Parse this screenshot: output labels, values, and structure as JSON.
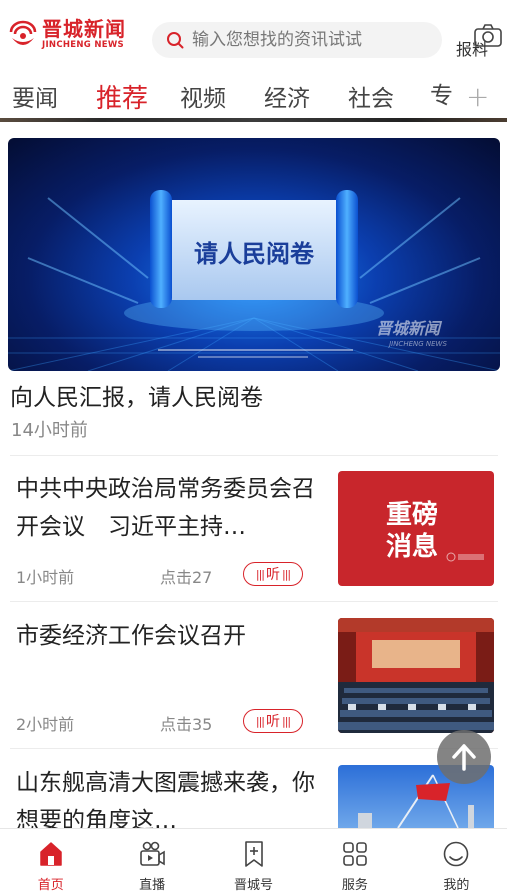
{
  "header": {
    "logo_cn": "晋城新闻",
    "logo_en": "JINCHENG NEWS",
    "search_placeholder": "输入您想找的资讯试试",
    "report_label": "报料"
  },
  "tabs": [
    {
      "label": "要闻",
      "active": false
    },
    {
      "label": "推荐",
      "active": true
    },
    {
      "label": "视频",
      "active": false
    },
    {
      "label": "经济",
      "active": false
    },
    {
      "label": "社会",
      "active": false
    },
    {
      "label": "专",
      "active": false
    }
  ],
  "hero": {
    "banner_text": "请人民阅卷",
    "watermark": "晋城新闻",
    "watermark_en": "JINCHENG NEWS",
    "title": "向人民汇报，请人民阅卷",
    "time": "14小时前"
  },
  "news": [
    {
      "title": "中共中央政治局常务委员会召开会议　习近平主持…",
      "time": "1小时前",
      "clicks": "点击27",
      "listen": "听",
      "thumb_text_1": "重磅",
      "thumb_text_2": "消息"
    },
    {
      "title": "市委经济工作会议召开",
      "time": "2小时前",
      "clicks": "点击35",
      "listen": "听"
    },
    {
      "title": "山东舰高清大图震撼来袭，你想要的角度这…"
    }
  ],
  "bottom_nav": [
    {
      "label": "首页",
      "icon": "home-icon",
      "active": true
    },
    {
      "label": "直播",
      "icon": "live-camera-icon",
      "active": false
    },
    {
      "label": "晋城号",
      "icon": "bookmark-icon",
      "active": false
    },
    {
      "label": "服务",
      "icon": "grid-icon",
      "active": false
    },
    {
      "label": "我的",
      "icon": "profile-icon",
      "active": false
    }
  ],
  "colors": {
    "accent": "#d8232a",
    "text": "#222222",
    "muted": "#888888"
  }
}
